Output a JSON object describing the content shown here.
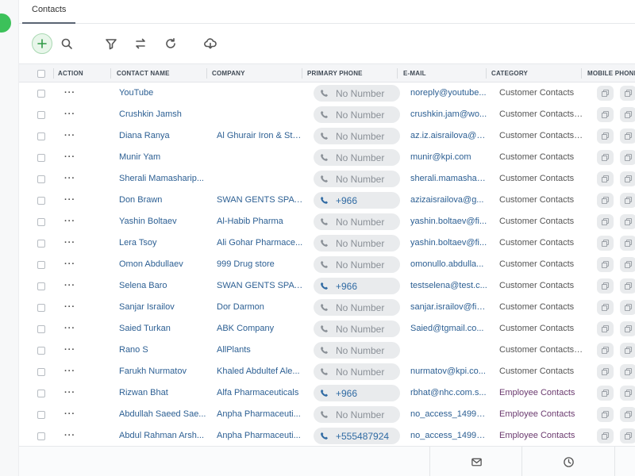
{
  "tabs": [
    {
      "label": "Contacts",
      "active": true
    }
  ],
  "toolbar": {
    "icons": [
      "add-icon",
      "search-icon",
      "filter-icon",
      "swap-icon",
      "refresh-icon",
      "cloud-download-icon"
    ]
  },
  "table": {
    "columns": [
      "ACTION",
      "CONTACT NAME",
      "COMPANY",
      "PRIMARY PHONE",
      "E-MAIL",
      "CATEGORY",
      "MOBILE PHONE"
    ],
    "action_label": "···",
    "rows": [
      {
        "name": "YouTube",
        "company": "",
        "phone": "No Number",
        "has_phone": false,
        "email": "noreply@youtube...",
        "category": "Customer Contacts"
      },
      {
        "name": "Crushkin Jamsh",
        "company": "",
        "phone": "No Number",
        "has_phone": false,
        "email": "crushkin.jam@wo...",
        "category": "Customer Contacts,..."
      },
      {
        "name": "Diana Ranya",
        "company": "Al Ghurair Iron & Ste...",
        "phone": "No Number",
        "has_phone": false,
        "email": "az.iz.aisrailova@g...",
        "category": "Customer Contacts,..."
      },
      {
        "name": "Munir Yam",
        "company": "",
        "phone": "No Number",
        "has_phone": false,
        "email": "munir@kpi.com",
        "category": "Customer Contacts"
      },
      {
        "name": "Sherali Mamasharip...",
        "company": "",
        "phone": "No Number",
        "has_phone": false,
        "email": "sherali.mamashari...",
        "category": "Customer Contacts"
      },
      {
        "name": "Don Brawn",
        "company": "SWAN GENTS SPA C...",
        "phone": "+966",
        "has_phone": true,
        "email": "azizaisrailova@g...",
        "category": "Customer Contacts"
      },
      {
        "name": "Yashin Boltaev",
        "company": "Al-Habib Pharma",
        "phone": "No Number",
        "has_phone": false,
        "email": "yashin.boltaev@fi...",
        "category": "Customer Contacts"
      },
      {
        "name": "Lera Tsoy",
        "company": "Ali Gohar Pharmace...",
        "phone": "No Number",
        "has_phone": false,
        "email": "yashin.boltaev@fi...",
        "category": "Customer Contacts"
      },
      {
        "name": "Omon Abdullaev",
        "company": "999 Drug store",
        "phone": "No Number",
        "has_phone": false,
        "email": "omonullo.abdulla...",
        "category": "Customer Contacts"
      },
      {
        "name": "Selena Baro",
        "company": "SWAN GENTS SPA C...",
        "phone": "+966",
        "has_phone": true,
        "email": "testselena@test.c...",
        "category": "Customer Contacts"
      },
      {
        "name": "Sanjar Israilov",
        "company": "Dor Darmon",
        "phone": "No Number",
        "has_phone": false,
        "email": "sanjar.israilov@fin...",
        "category": "Customer Contacts"
      },
      {
        "name": "Saied Turkan",
        "company": "ABK Company",
        "phone": "No Number",
        "has_phone": false,
        "email": "Saied@tgmail.co...",
        "category": "Customer Contacts"
      },
      {
        "name": "Rano S",
        "company": "AllPlants",
        "phone": "No Number",
        "has_phone": false,
        "email": "",
        "category": "Customer Contacts,..."
      },
      {
        "name": "Farukh Nurmatov",
        "company": "Khaled Abdultef Ale...",
        "phone": "No Number",
        "has_phone": false,
        "email": "nurmatov@kpi.co...",
        "category": "Customer Contacts"
      },
      {
        "name": "Rizwan Bhat",
        "company": "Alfa Pharmaceuticals",
        "phone": "+966",
        "has_phone": true,
        "email": "rbhat@nhc.com.s...",
        "category": "Employee Contacts"
      },
      {
        "name": "Abdullah Saeed Sae...",
        "company": "Anpha Pharmaceuti...",
        "phone": "No Number",
        "has_phone": false,
        "email": "no_access_149932...",
        "category": "Employee Contacts"
      },
      {
        "name": "Abdul Rahman Arsh...",
        "company": "Anpha Pharmaceuti...",
        "phone": "+555487924",
        "has_phone": true,
        "email": "no_access_149932...",
        "category": "Employee Contacts"
      }
    ]
  },
  "footer": {
    "icons": [
      "mail-icon",
      "clock-icon"
    ]
  },
  "colors": {
    "accent_green": "#3cc15a",
    "link_blue": "#2c5f93",
    "employee_purple": "#6b3a6f",
    "pill_bg": "#e9ebed"
  }
}
